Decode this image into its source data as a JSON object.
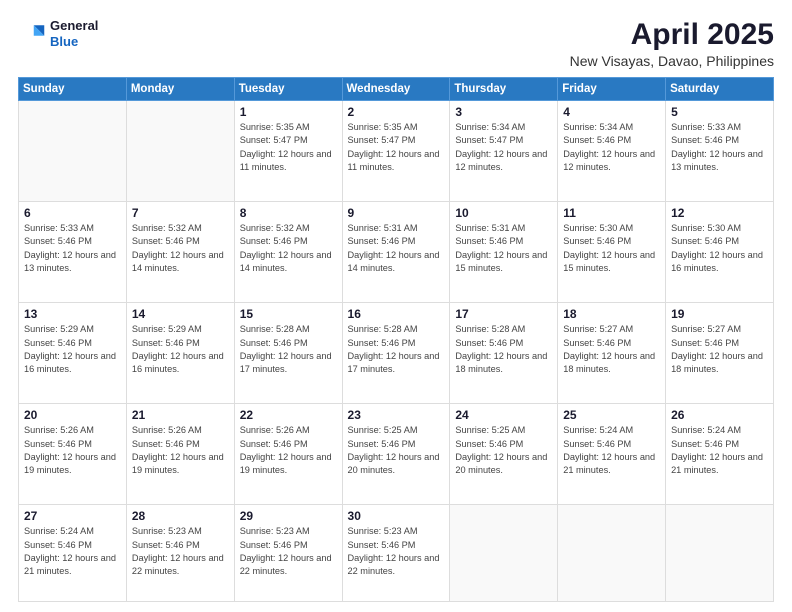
{
  "header": {
    "logo": {
      "general": "General",
      "blue": "Blue"
    },
    "title": "April 2025",
    "location": "New Visayas, Davao, Philippines"
  },
  "weekdays": [
    "Sunday",
    "Monday",
    "Tuesday",
    "Wednesday",
    "Thursday",
    "Friday",
    "Saturday"
  ],
  "weeks": [
    [
      {
        "day": null
      },
      {
        "day": null
      },
      {
        "day": "1",
        "sunrise": "Sunrise: 5:35 AM",
        "sunset": "Sunset: 5:47 PM",
        "daylight": "Daylight: 12 hours and 11 minutes."
      },
      {
        "day": "2",
        "sunrise": "Sunrise: 5:35 AM",
        "sunset": "Sunset: 5:47 PM",
        "daylight": "Daylight: 12 hours and 11 minutes."
      },
      {
        "day": "3",
        "sunrise": "Sunrise: 5:34 AM",
        "sunset": "Sunset: 5:47 PM",
        "daylight": "Daylight: 12 hours and 12 minutes."
      },
      {
        "day": "4",
        "sunrise": "Sunrise: 5:34 AM",
        "sunset": "Sunset: 5:46 PM",
        "daylight": "Daylight: 12 hours and 12 minutes."
      },
      {
        "day": "5",
        "sunrise": "Sunrise: 5:33 AM",
        "sunset": "Sunset: 5:46 PM",
        "daylight": "Daylight: 12 hours and 13 minutes."
      }
    ],
    [
      {
        "day": "6",
        "sunrise": "Sunrise: 5:33 AM",
        "sunset": "Sunset: 5:46 PM",
        "daylight": "Daylight: 12 hours and 13 minutes."
      },
      {
        "day": "7",
        "sunrise": "Sunrise: 5:32 AM",
        "sunset": "Sunset: 5:46 PM",
        "daylight": "Daylight: 12 hours and 14 minutes."
      },
      {
        "day": "8",
        "sunrise": "Sunrise: 5:32 AM",
        "sunset": "Sunset: 5:46 PM",
        "daylight": "Daylight: 12 hours and 14 minutes."
      },
      {
        "day": "9",
        "sunrise": "Sunrise: 5:31 AM",
        "sunset": "Sunset: 5:46 PM",
        "daylight": "Daylight: 12 hours and 14 minutes."
      },
      {
        "day": "10",
        "sunrise": "Sunrise: 5:31 AM",
        "sunset": "Sunset: 5:46 PM",
        "daylight": "Daylight: 12 hours and 15 minutes."
      },
      {
        "day": "11",
        "sunrise": "Sunrise: 5:30 AM",
        "sunset": "Sunset: 5:46 PM",
        "daylight": "Daylight: 12 hours and 15 minutes."
      },
      {
        "day": "12",
        "sunrise": "Sunrise: 5:30 AM",
        "sunset": "Sunset: 5:46 PM",
        "daylight": "Daylight: 12 hours and 16 minutes."
      }
    ],
    [
      {
        "day": "13",
        "sunrise": "Sunrise: 5:29 AM",
        "sunset": "Sunset: 5:46 PM",
        "daylight": "Daylight: 12 hours and 16 minutes."
      },
      {
        "day": "14",
        "sunrise": "Sunrise: 5:29 AM",
        "sunset": "Sunset: 5:46 PM",
        "daylight": "Daylight: 12 hours and 16 minutes."
      },
      {
        "day": "15",
        "sunrise": "Sunrise: 5:28 AM",
        "sunset": "Sunset: 5:46 PM",
        "daylight": "Daylight: 12 hours and 17 minutes."
      },
      {
        "day": "16",
        "sunrise": "Sunrise: 5:28 AM",
        "sunset": "Sunset: 5:46 PM",
        "daylight": "Daylight: 12 hours and 17 minutes."
      },
      {
        "day": "17",
        "sunrise": "Sunrise: 5:28 AM",
        "sunset": "Sunset: 5:46 PM",
        "daylight": "Daylight: 12 hours and 18 minutes."
      },
      {
        "day": "18",
        "sunrise": "Sunrise: 5:27 AM",
        "sunset": "Sunset: 5:46 PM",
        "daylight": "Daylight: 12 hours and 18 minutes."
      },
      {
        "day": "19",
        "sunrise": "Sunrise: 5:27 AM",
        "sunset": "Sunset: 5:46 PM",
        "daylight": "Daylight: 12 hours and 18 minutes."
      }
    ],
    [
      {
        "day": "20",
        "sunrise": "Sunrise: 5:26 AM",
        "sunset": "Sunset: 5:46 PM",
        "daylight": "Daylight: 12 hours and 19 minutes."
      },
      {
        "day": "21",
        "sunrise": "Sunrise: 5:26 AM",
        "sunset": "Sunset: 5:46 PM",
        "daylight": "Daylight: 12 hours and 19 minutes."
      },
      {
        "day": "22",
        "sunrise": "Sunrise: 5:26 AM",
        "sunset": "Sunset: 5:46 PM",
        "daylight": "Daylight: 12 hours and 19 minutes."
      },
      {
        "day": "23",
        "sunrise": "Sunrise: 5:25 AM",
        "sunset": "Sunset: 5:46 PM",
        "daylight": "Daylight: 12 hours and 20 minutes."
      },
      {
        "day": "24",
        "sunrise": "Sunrise: 5:25 AM",
        "sunset": "Sunset: 5:46 PM",
        "daylight": "Daylight: 12 hours and 20 minutes."
      },
      {
        "day": "25",
        "sunrise": "Sunrise: 5:24 AM",
        "sunset": "Sunset: 5:46 PM",
        "daylight": "Daylight: 12 hours and 21 minutes."
      },
      {
        "day": "26",
        "sunrise": "Sunrise: 5:24 AM",
        "sunset": "Sunset: 5:46 PM",
        "daylight": "Daylight: 12 hours and 21 minutes."
      }
    ],
    [
      {
        "day": "27",
        "sunrise": "Sunrise: 5:24 AM",
        "sunset": "Sunset: 5:46 PM",
        "daylight": "Daylight: 12 hours and 21 minutes."
      },
      {
        "day": "28",
        "sunrise": "Sunrise: 5:23 AM",
        "sunset": "Sunset: 5:46 PM",
        "daylight": "Daylight: 12 hours and 22 minutes."
      },
      {
        "day": "29",
        "sunrise": "Sunrise: 5:23 AM",
        "sunset": "Sunset: 5:46 PM",
        "daylight": "Daylight: 12 hours and 22 minutes."
      },
      {
        "day": "30",
        "sunrise": "Sunrise: 5:23 AM",
        "sunset": "Sunset: 5:46 PM",
        "daylight": "Daylight: 12 hours and 22 minutes."
      },
      {
        "day": null
      },
      {
        "day": null
      },
      {
        "day": null
      }
    ]
  ]
}
